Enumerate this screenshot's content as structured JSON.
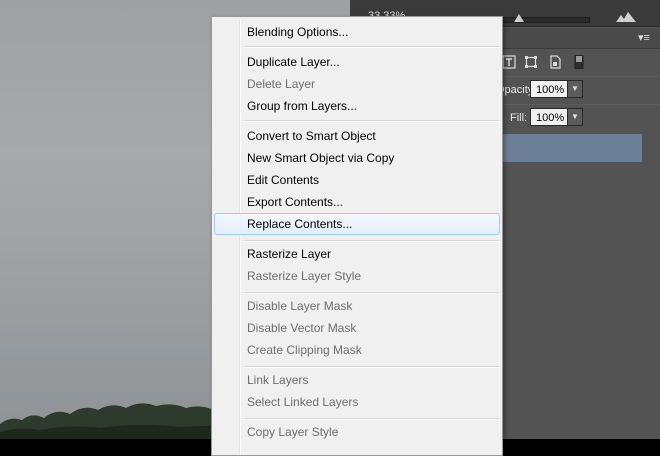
{
  "app": {
    "zoom_text": "33.33%",
    "menu_icon_glyph": "▾≡"
  },
  "options": {
    "opacity_label": "Opacity:",
    "opacity_value": "100%",
    "fill_label": "Fill:",
    "fill_value": "100%",
    "dropdown_glyph": "▼"
  },
  "context_menu": {
    "items": [
      {
        "label": "Blending Options...",
        "enabled": true
      },
      {
        "label": "Duplicate Layer...",
        "enabled": true
      },
      {
        "label": "Delete Layer",
        "enabled": false
      },
      {
        "label": "Group from Layers...",
        "enabled": true
      },
      {
        "label": "Convert to Smart Object",
        "enabled": true
      },
      {
        "label": "New Smart Object via Copy",
        "enabled": true
      },
      {
        "label": "Edit Contents",
        "enabled": true
      },
      {
        "label": "Export Contents...",
        "enabled": true
      },
      {
        "label": "Replace Contents...",
        "enabled": true,
        "hovered": true
      },
      {
        "label": "Rasterize Layer",
        "enabled": true
      },
      {
        "label": "Rasterize Layer Style",
        "enabled": false
      },
      {
        "label": "Disable Layer Mask",
        "enabled": false
      },
      {
        "label": "Disable Vector Mask",
        "enabled": false
      },
      {
        "label": "Create Clipping Mask",
        "enabled": false
      },
      {
        "label": "Link Layers",
        "enabled": false
      },
      {
        "label": "Select Linked Layers",
        "enabled": false
      },
      {
        "label": "Copy Layer Style",
        "enabled": false
      }
    ]
  },
  "colors": {
    "selected_layer": "#6c7f97",
    "menu_hover_border": "#a8caf1",
    "panel_bg": "#535353"
  }
}
